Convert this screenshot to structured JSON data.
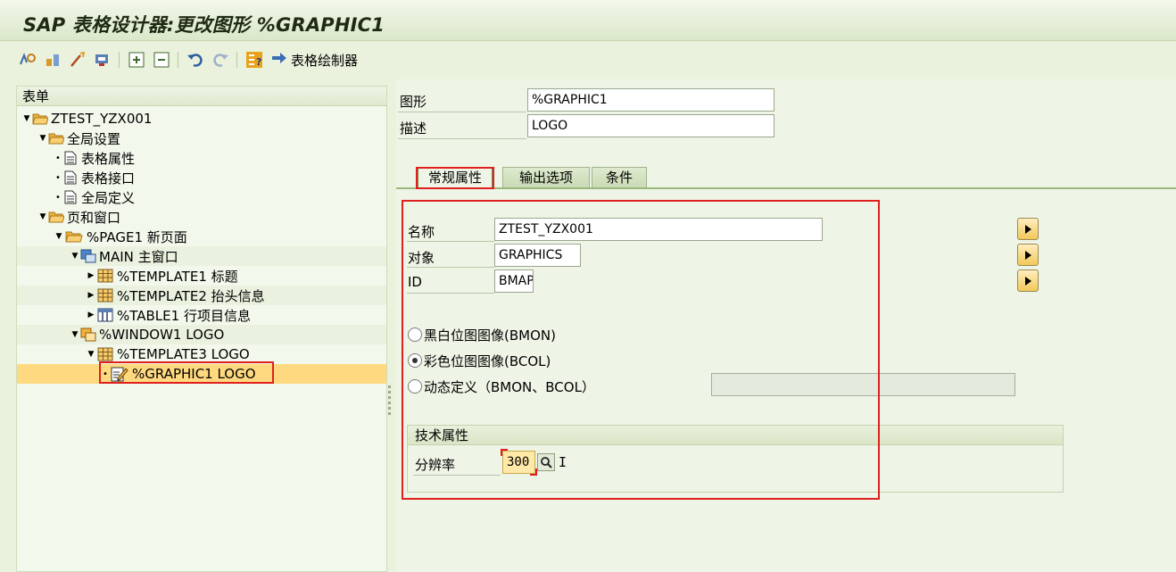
{
  "window": {
    "title": "SAP 表格设计器:更改图形 %GRAPHIC1"
  },
  "toolbar": {
    "icons": [
      "display-change-icon",
      "check-icon",
      "test-icon",
      "activate-icon",
      "expand-icon",
      "collapse-icon",
      "undo-icon",
      "redo-icon",
      "field-list-icon"
    ],
    "form_painter_label": "表格绘制器"
  },
  "tree": {
    "header": "表单",
    "nodes": [
      {
        "label": "ZTEST_YZX001",
        "icon": "folder-open-icon"
      },
      {
        "label": "全局设置",
        "icon": "folder-open-icon"
      },
      {
        "label": "表格属性",
        "icon": "document-icon"
      },
      {
        "label": "表格接口",
        "icon": "document-icon"
      },
      {
        "label": "全局定义",
        "icon": "document-icon"
      },
      {
        "label": "页和窗口",
        "icon": "folder-open-icon"
      },
      {
        "label": "%PAGE1 新页面",
        "icon": "folder-open-icon"
      },
      {
        "label": "MAIN 主窗口",
        "icon": "window-icon"
      },
      {
        "label": "%TEMPLATE1 标题",
        "icon": "template-icon"
      },
      {
        "label": "%TEMPLATE2 抬头信息",
        "icon": "template-icon"
      },
      {
        "label": "%TABLE1 行项目信息",
        "icon": "table-icon"
      },
      {
        "label": "%WINDOW1 LOGO",
        "icon": "secondary-window-icon"
      },
      {
        "label": "%TEMPLATE3 LOGO",
        "icon": "template-icon"
      },
      {
        "label": "%GRAPHIC1 LOGO",
        "icon": "graphic-edit-icon"
      }
    ]
  },
  "header_fields": {
    "graphic_label": "图形",
    "graphic_value": "%GRAPHIC1",
    "desc_label": "描述",
    "desc_value": "LOGO"
  },
  "tabs": [
    {
      "label": "常规属性",
      "active": true
    },
    {
      "label": "输出选项",
      "active": false
    },
    {
      "label": "条件",
      "active": false
    }
  ],
  "general": {
    "name_label": "名称",
    "name_value": "ZTEST_YZX001",
    "object_label": "对象",
    "object_value": "GRAPHICS",
    "id_label": "ID",
    "id_value": "BMAP",
    "radio_bw": "黑白位图图像(BMON)",
    "radio_color": "彩色位图图像(BCOL)",
    "radio_dynamic": "动态定义（BMON、BCOL）",
    "selected_radio": "radio_color"
  },
  "tech": {
    "title": "技术属性",
    "resolution_label": "分辨率",
    "resolution_value": "300",
    "unit": "I"
  },
  "colors": {
    "accent_red": "#e0201e",
    "selection": "#ffd980",
    "background": "#e9f2dc"
  }
}
